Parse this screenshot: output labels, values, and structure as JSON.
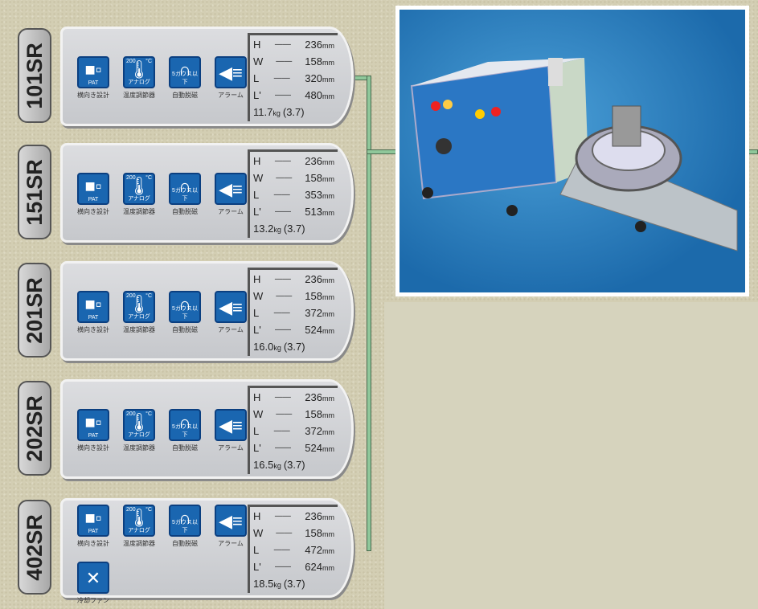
{
  "icon_labels": {
    "pat": "PAT",
    "analog_top": "200",
    "celsius": "°C",
    "analog": "アナログ",
    "gauss": "5ガウス以下"
  },
  "feature_labels": {
    "horizontal": "横向き設計",
    "temp": "温度調節器",
    "demag": "自動脱磁",
    "alarm": "アラーム",
    "fan": "冷却ファン"
  },
  "colors": {
    "icon_blue": "#1a66b0",
    "connector_green": "#8fc79a"
  },
  "models": [
    {
      "name": "101SR",
      "H": "236",
      "W": "158",
      "L": "320",
      "L2": "480",
      "weight": "11.7",
      "power": "(3.7)"
    },
    {
      "name": "151SR",
      "H": "236",
      "W": "158",
      "L": "353",
      "L2": "513",
      "weight": "13.2",
      "power": "(3.7)"
    },
    {
      "name": "201SR",
      "H": "236",
      "W": "158",
      "L": "372",
      "L2": "524",
      "weight": "16.0",
      "power": "(3.7)"
    },
    {
      "name": "202SR",
      "H": "236",
      "W": "158",
      "L": "372",
      "L2": "524",
      "weight": "16.5",
      "power": "(3.7)"
    },
    {
      "name": "402SR",
      "H": "236",
      "W": "158",
      "L": "472",
      "L2": "624",
      "weight": "18.5",
      "power": "(3.7)",
      "fan": true
    }
  ],
  "units": {
    "mm": "mm",
    "kg": "kg"
  },
  "spec_keys": {
    "H": "H",
    "W": "W",
    "L": "L",
    "L2": "L'",
    "dash": "——"
  }
}
